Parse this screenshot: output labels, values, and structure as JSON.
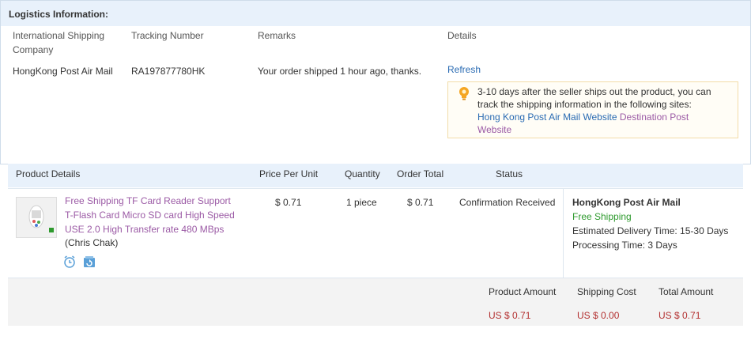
{
  "logistics": {
    "title": "Logistics Information:",
    "headers": {
      "company_line1": "International Shipping",
      "company_line2": "Company",
      "tracking": "Tracking Number",
      "remarks": "Remarks",
      "details": "Details"
    },
    "row": {
      "company": "HongKong Post Air Mail",
      "tracking": "RA197877780HK",
      "remarks": "Your order shipped 1 hour ago, thanks.",
      "refresh": "Refresh"
    },
    "tip": {
      "line1": "3-10 days after the seller ships out the product, you can",
      "line2": "track the shipping information in the following sites:",
      "link1": "Hong Kong Post Air Mail Website",
      "link2a": "Destination Post",
      "link2b": "Website"
    }
  },
  "products": {
    "headers": {
      "details": "Product Details",
      "price": "Price Per Unit",
      "quantity": "Quantity",
      "total": "Order Total",
      "status": "Status"
    },
    "item": {
      "title_line1": "Free Shipping TF Card Reader Support",
      "title_line2": "T-Flash Card Micro SD card High Speed",
      "title_line3": "USE 2.0 High Transfer rate 480 MBps",
      "seller": "(Chris Chak)",
      "price": "$ 0.71",
      "quantity": "1 piece",
      "total": "$ 0.71",
      "status": "Confirmation Received",
      "icons": [
        "alarm-clock-icon",
        "refresh-box-icon"
      ]
    },
    "shipping": {
      "carrier": "HongKong Post Air Mail",
      "free": "Free Shipping",
      "delivery_label": "Estimated Delivery Time:",
      "delivery_value": "15-30 Days",
      "processing_label": "Processing Time:",
      "processing_value": "3 Days"
    }
  },
  "totals": {
    "product_amount_label": "Product Amount",
    "shipping_cost_label": "Shipping Cost",
    "total_amount_label": "Total Amount",
    "product_amount": "US $ 0.71",
    "shipping_cost": "US $ 0.00",
    "total_amount": "US $ 0.71"
  },
  "colors": {
    "link_blue": "#2a6bb3",
    "link_purple": "#9b5aa5",
    "free_green": "#2e9a2e",
    "amount_red": "#b33030",
    "header_bg": "#e8f1fb"
  }
}
